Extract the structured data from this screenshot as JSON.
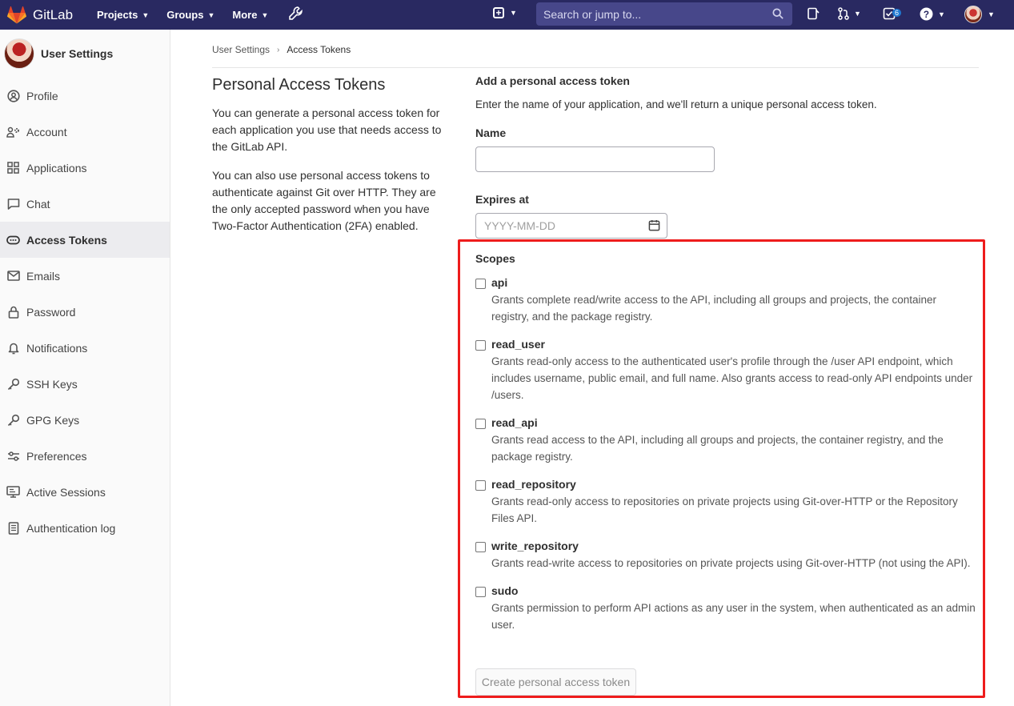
{
  "topbar": {
    "brand": "GitLab",
    "nav": [
      {
        "label": "Projects"
      },
      {
        "label": "Groups"
      },
      {
        "label": "More"
      }
    ],
    "search_placeholder": "Search or jump to...",
    "todo_count": "6"
  },
  "sidebar": {
    "title": "User Settings",
    "items": [
      {
        "label": "Profile",
        "icon": "profile-icon"
      },
      {
        "label": "Account",
        "icon": "account-icon"
      },
      {
        "label": "Applications",
        "icon": "applications-icon"
      },
      {
        "label": "Chat",
        "icon": "chat-icon"
      },
      {
        "label": "Access Tokens",
        "icon": "token-icon",
        "active": true
      },
      {
        "label": "Emails",
        "icon": "mail-icon"
      },
      {
        "label": "Password",
        "icon": "lock-icon"
      },
      {
        "label": "Notifications",
        "icon": "bell-icon"
      },
      {
        "label": "SSH Keys",
        "icon": "key-icon"
      },
      {
        "label": "GPG Keys",
        "icon": "key-icon"
      },
      {
        "label": "Preferences",
        "icon": "preferences-icon"
      },
      {
        "label": "Active Sessions",
        "icon": "monitor-icon"
      },
      {
        "label": "Authentication log",
        "icon": "log-icon"
      }
    ]
  },
  "breadcrumb": {
    "parent": "User Settings",
    "current": "Access Tokens"
  },
  "intro": {
    "title": "Personal Access Tokens",
    "p1": "You can generate a personal access token for each application you use that needs access to the GitLab API.",
    "p2": "You can also use personal access tokens to authenticate against Git over HTTP. They are the only accepted password when you have Two-Factor Authentication (2FA) enabled."
  },
  "form": {
    "heading": "Add a personal access token",
    "description": "Enter the name of your application, and we'll return a unique personal access token.",
    "name_label": "Name",
    "name_value": "",
    "expires_label": "Expires at",
    "expires_placeholder": "YYYY-MM-DD",
    "scopes_label": "Scopes",
    "scopes": [
      {
        "name": "api",
        "desc": "Grants complete read/write access to the API, including all groups and projects, the container registry, and the package registry."
      },
      {
        "name": "read_user",
        "desc": "Grants read-only access to the authenticated user's profile through the /user API endpoint, which includes username, public email, and full name. Also grants access to read-only API endpoints under /users."
      },
      {
        "name": "read_api",
        "desc": "Grants read access to the API, including all groups and projects, the container registry, and the package registry."
      },
      {
        "name": "read_repository",
        "desc": "Grants read-only access to repositories on private projects using Git-over-HTTP or the Repository Files API."
      },
      {
        "name": "write_repository",
        "desc": "Grants read-write access to repositories on private projects using Git-over-HTTP (not using the API)."
      },
      {
        "name": "sudo",
        "desc": "Grants permission to perform API actions as any user in the system, when authenticated as an admin user."
      }
    ],
    "submit_label": "Create personal access token"
  }
}
